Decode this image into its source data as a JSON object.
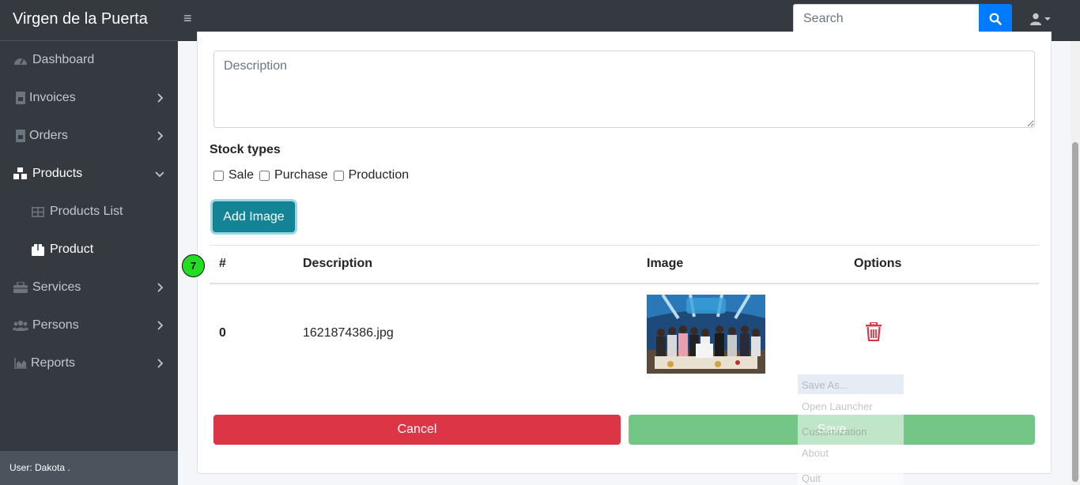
{
  "app": {
    "brand": "Virgen de la Puerta"
  },
  "search": {
    "placeholder": "Search"
  },
  "sidebar": {
    "items": [
      {
        "label": "Dashboard",
        "icon": "dashboard-icon"
      },
      {
        "label": "Invoices",
        "icon": "file-invoice-icon"
      },
      {
        "label": "Orders",
        "icon": "file-icon"
      },
      {
        "label": "Products",
        "icon": "cubes-icon"
      },
      {
        "label": "Products List",
        "icon": "table-icon"
      },
      {
        "label": "Product",
        "icon": "box-icon"
      },
      {
        "label": "Services",
        "icon": "toolbox-icon"
      },
      {
        "label": "Persons",
        "icon": "users-icon"
      },
      {
        "label": "Reports",
        "icon": "chart-area-icon"
      }
    ],
    "footer": "User: Dakota ."
  },
  "form": {
    "description_placeholder": "Description",
    "stock_types_label": "Stock types",
    "checkboxes": [
      {
        "label": "Sale",
        "checked": false
      },
      {
        "label": "Purchase",
        "checked": false
      },
      {
        "label": "Production",
        "checked": false
      }
    ],
    "add_image_label": "Add Image"
  },
  "table": {
    "columns": [
      "#",
      "Description",
      "Image",
      "Options"
    ],
    "rows": [
      {
        "index": "0",
        "description": "1621874386.jpg"
      }
    ]
  },
  "badge": "7",
  "buttons": {
    "cancel": "Cancel",
    "save": "Save"
  },
  "ghost_menu": [
    "Save As...",
    "Open Launcher",
    "Customization",
    "About",
    "Quit"
  ],
  "colors": {
    "sidebar": "#343a40",
    "primary": "#007bff",
    "info": "#17a2b8",
    "danger": "#dc3545",
    "success": "#74c687"
  }
}
